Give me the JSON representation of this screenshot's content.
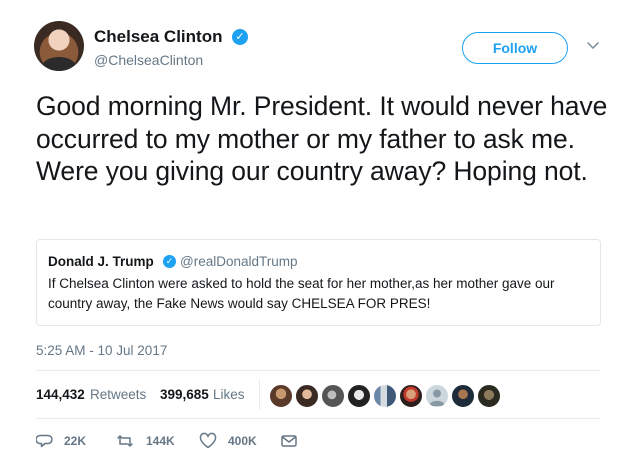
{
  "author": {
    "name": "Chelsea Clinton",
    "handle": "@ChelseaClinton",
    "verified": true
  },
  "follow_button": {
    "label": "Follow"
  },
  "tweet": {
    "text": "Good morning Mr. President. It would never have occurred to my mother or my father to ask me. Were you giving our country away? Hoping not.",
    "timestamp": "5:25 AM - 10 Jul 2017"
  },
  "quoted_tweet": {
    "name": "Donald J. Trump",
    "handle": "@realDonaldTrump",
    "verified": true,
    "text": "If Chelsea Clinton were asked to hold the seat for her mother,as her mother gave our country away, the Fake News would say CHELSEA FOR PRES!"
  },
  "stats": {
    "retweets_count": "144,432",
    "retweets_label": "Retweets",
    "likes_count": "399,685",
    "likes_label": "Likes"
  },
  "actions": {
    "replies": "22K",
    "retweets": "144K",
    "likes": "400K"
  },
  "colors": {
    "accent": "#1da1f2",
    "muted": "#657786",
    "text": "#14171a",
    "border": "#e1e8ed"
  }
}
